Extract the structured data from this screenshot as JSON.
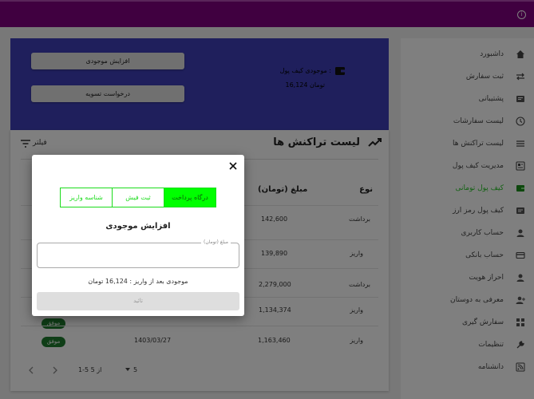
{
  "topbar": {
    "info_icon": "info-icon",
    "color": "#800080"
  },
  "sidebar": {
    "items": [
      {
        "label": "داشبورد",
        "icon": "home-icon"
      },
      {
        "label": "ثبت سفارش",
        "icon": "arrows-icon"
      },
      {
        "label": "پشتیبانی",
        "icon": "support-icon"
      },
      {
        "label": "لیست سفارشات",
        "icon": "clock-icon"
      },
      {
        "label": "لیست تراکنش ها",
        "icon": "list-icon"
      },
      {
        "label": "مدیریت کیف پول",
        "icon": "wallet-manage-icon"
      },
      {
        "label": "کیف پول تومانی",
        "icon": "wallet-icon"
      },
      {
        "label": "کیف پول رمز ارز",
        "icon": "crypto-wallet-icon"
      },
      {
        "label": "حساب کاربری",
        "icon": "user-icon"
      },
      {
        "label": "حساب بانکی",
        "icon": "card-icon"
      },
      {
        "label": "احراز هویت",
        "icon": "id-icon"
      },
      {
        "label": "معرفی به دوستان",
        "icon": "referral-icon"
      },
      {
        "label": "سفارش گیری",
        "icon": "grid-icon"
      },
      {
        "label": "تنظیمات",
        "icon": "wrench-icon"
      },
      {
        "label": "دانشنامه",
        "icon": "rss-icon"
      }
    ],
    "active_index": 6,
    "accent": "#28c528"
  },
  "wallet": {
    "increase_btn": "افزایش موجودی",
    "settle_btn": "درخواست تسویه",
    "balance_label": "موجودی کیف پول :",
    "balance_value": "16,124 تومان",
    "card_color": "#3e3fb8"
  },
  "transactions": {
    "title": "لیست تراکنش ها",
    "filter_label": "فیلتر",
    "headers": {
      "type": "نوع",
      "amount": "مبلغ (تومان)"
    },
    "rows": [
      {
        "type": "برداشت",
        "amount": "142,600",
        "date": "",
        "status": ""
      },
      {
        "type": "واریز",
        "amount": "139,890",
        "date": "",
        "status": ""
      },
      {
        "type": "برداشت",
        "amount": "2,279,000",
        "date": "",
        "status": ""
      },
      {
        "type": "واریز",
        "amount": "1,134,374",
        "date": "",
        "status": ""
      },
      {
        "type": "واریز",
        "amount": "1,163,460",
        "date": "1403/03/27",
        "status": "موفق"
      }
    ],
    "pagination": {
      "per_page": "5",
      "range": "1-5 از 5"
    }
  },
  "modal": {
    "tabs": [
      "درگاه پرداخت",
      "ثبت فیش",
      "شناسه واریز"
    ],
    "active_tab": 0,
    "title": "افزایش موجودی",
    "amount_label": "مبلغ (تومان)",
    "amount_value": "",
    "balance_after": "موجودی بعد از واریز : 16,124 تومان",
    "submit": "تائید",
    "tab_color": "#00ff00"
  }
}
